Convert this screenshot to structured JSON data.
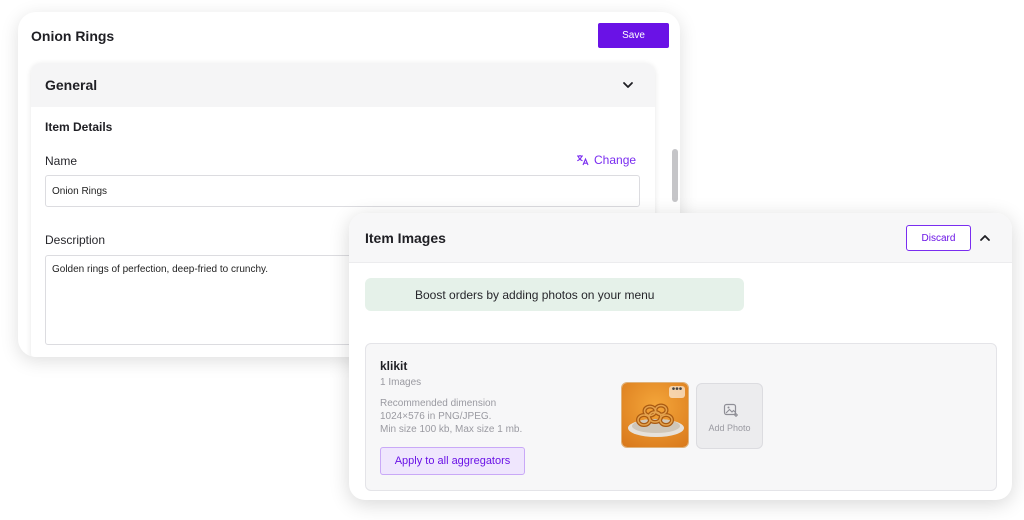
{
  "item_editor": {
    "title": "Onion Rings",
    "save_label": "Save",
    "general": {
      "title": "General",
      "section_title": "Item Details",
      "name_label": "Name",
      "change_label": "Change",
      "name_value": "Onion Rings",
      "description_label": "Description",
      "description_value": "Golden rings of perfection, deep-fried to crunchy."
    }
  },
  "item_images": {
    "title": "Item Images",
    "discard_label": "Discard",
    "boost_text": "Boost orders by adding photos on your menu",
    "aggregator": {
      "name": "klikit",
      "image_count": "1 Images",
      "recommendation_lines": [
        "Recommended dimension",
        "1024×576 in PNG/JPEG.",
        "Min size 100 kb, Max size 1 mb."
      ],
      "apply_label": "Apply to all aggregators",
      "add_photo_label": "Add Photo"
    }
  },
  "colors": {
    "accent": "#6a12e6",
    "boost_bg": "#e5f1e9"
  },
  "icons": {
    "translate": "translate-icon",
    "chevron_down": "chevron-down-icon",
    "chevron_up": "chevron-up-icon",
    "add_photo": "add-photo-icon",
    "more": "more-options-icon"
  }
}
